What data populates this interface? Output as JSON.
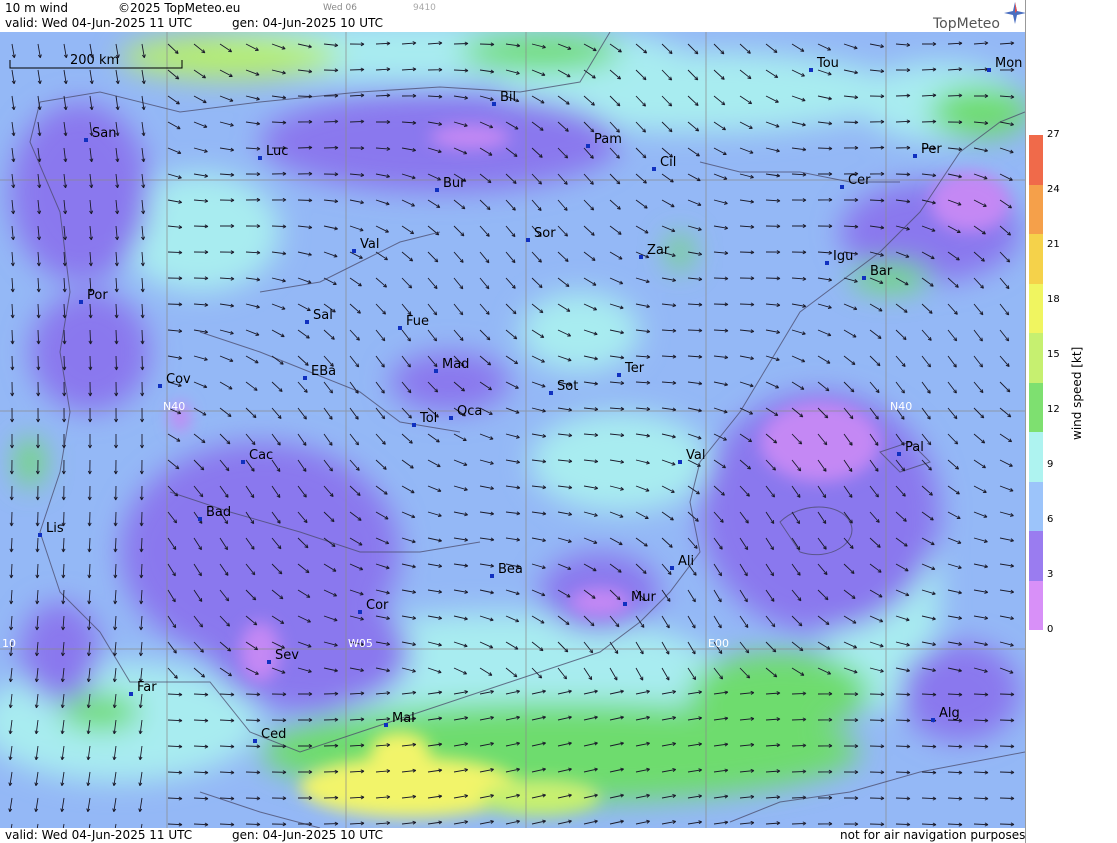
{
  "header": {
    "product": "10 m wind",
    "copyright": "©2025 TopMeteo.eu",
    "valid": "valid:  Wed  04-Jun-2025  11 UTC",
    "gen": "gen: 04-Jun-2025 10 UTC",
    "small_day": "Wed 06",
    "small_code": "9410",
    "logo": "TopMeteo"
  },
  "footer": {
    "valid": "valid:  Wed  04-Jun-2025  11 UTC",
    "gen": "gen: 04-Jun-2025 10 UTC",
    "note": "not for air navigation purposes"
  },
  "scale_bar": "200 km",
  "legend": {
    "title": "wind speed  [kt]",
    "ticks": [
      "27",
      "24",
      "21",
      "18",
      "15",
      "12",
      "9",
      "6",
      "3",
      "0"
    ],
    "colors": [
      "#f06a4a",
      "#f5a04a",
      "#f5d24a",
      "#f0f560",
      "#c6f070",
      "#7ee070",
      "#aef3f0",
      "#9cc4fa",
      "#9a7cf0",
      "#d890f8"
    ]
  },
  "grid_labels": [
    "N40",
    "N40",
    "W05",
    "E00",
    "10"
  ],
  "cities": [
    {
      "name": "Tou"
    },
    {
      "name": "Mon"
    },
    {
      "name": "Bil"
    },
    {
      "name": "San"
    },
    {
      "name": "Pam"
    },
    {
      "name": "Per"
    },
    {
      "name": "Luc"
    },
    {
      "name": "Cil"
    },
    {
      "name": "Bur"
    },
    {
      "name": "Cer"
    },
    {
      "name": "Sor"
    },
    {
      "name": "Val"
    },
    {
      "name": "Zar"
    },
    {
      "name": "Igu"
    },
    {
      "name": "Bar"
    },
    {
      "name": "Por"
    },
    {
      "name": "Sal"
    },
    {
      "name": "Fue"
    },
    {
      "name": "Mad"
    },
    {
      "name": "Ter"
    },
    {
      "name": "Cov"
    },
    {
      "name": "EBa"
    },
    {
      "name": "Sot"
    },
    {
      "name": "Tol"
    },
    {
      "name": "Oca"
    },
    {
      "name": "Pal"
    },
    {
      "name": "Cac"
    },
    {
      "name": "Val"
    },
    {
      "name": "Bad"
    },
    {
      "name": "Lis"
    },
    {
      "name": "Ali"
    },
    {
      "name": "Bea"
    },
    {
      "name": "Cor"
    },
    {
      "name": "Mur"
    },
    {
      "name": "Sev"
    },
    {
      "name": "Far"
    },
    {
      "name": "Mal"
    },
    {
      "name": "Alg"
    },
    {
      "name": "Ced"
    }
  ],
  "icons": [
    "compass-star-icon"
  ]
}
